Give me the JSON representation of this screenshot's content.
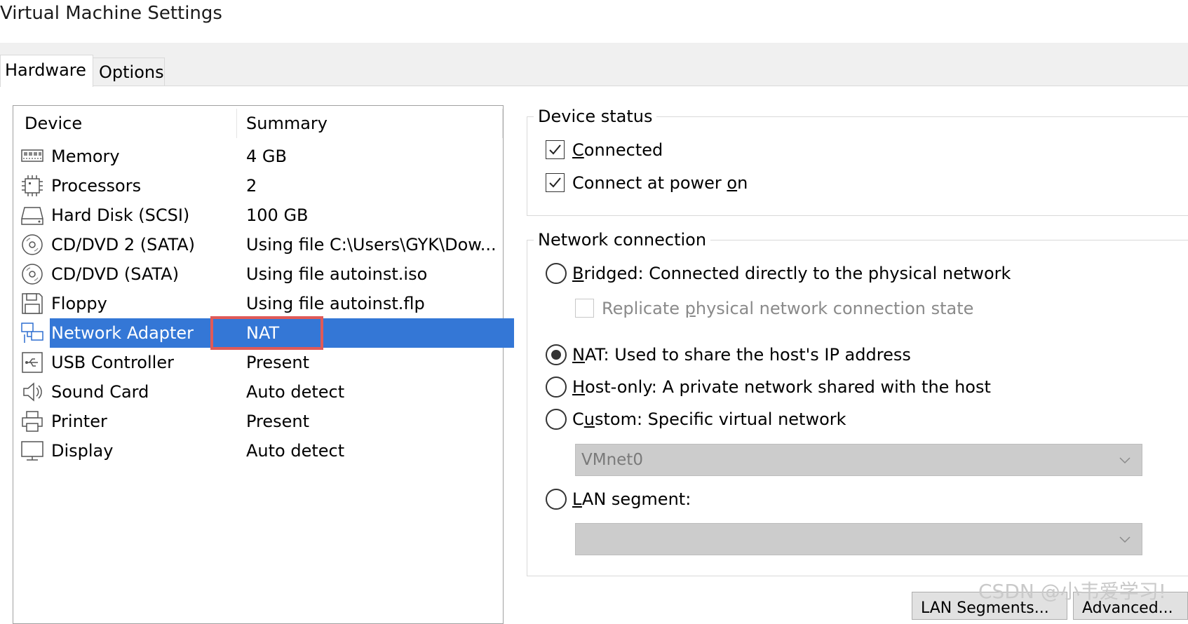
{
  "window": {
    "title": "Virtual Machine Settings"
  },
  "tabs": [
    {
      "label": "Hardware",
      "active": true
    },
    {
      "label": "Options",
      "active": false
    }
  ],
  "device_list": {
    "columns": [
      "Device",
      "Summary"
    ],
    "rows": [
      {
        "icon": "memory-icon",
        "device": "Memory",
        "summary": "4 GB"
      },
      {
        "icon": "processor-icon",
        "device": "Processors",
        "summary": "2"
      },
      {
        "icon": "hard-disk-icon",
        "device": "Hard Disk (SCSI)",
        "summary": "100 GB"
      },
      {
        "icon": "cd-dvd-icon",
        "device": "CD/DVD 2 (SATA)",
        "summary": "Using file C:\\Users\\GYK\\Dow..."
      },
      {
        "icon": "cd-dvd-icon",
        "device": "CD/DVD (SATA)",
        "summary": "Using file autoinst.iso"
      },
      {
        "icon": "floppy-icon",
        "device": "Floppy",
        "summary": "Using file autoinst.flp"
      },
      {
        "icon": "network-adapter-icon",
        "device": "Network Adapter",
        "summary": "NAT",
        "selected": true
      },
      {
        "icon": "usb-icon",
        "device": "USB Controller",
        "summary": "Present"
      },
      {
        "icon": "sound-card-icon",
        "device": "Sound Card",
        "summary": "Auto detect"
      },
      {
        "icon": "printer-icon",
        "device": "Printer",
        "summary": "Present"
      },
      {
        "icon": "display-icon",
        "device": "Display",
        "summary": "Auto detect"
      }
    ]
  },
  "device_status": {
    "title": "Device status",
    "connected": {
      "pre": "",
      "key": "C",
      "post": "onnected",
      "checked": true
    },
    "connect_at_power_on": {
      "pre": "Connect at power ",
      "key": "o",
      "post": "n",
      "checked": true
    }
  },
  "network_connection": {
    "title": "Network connection",
    "bridged": {
      "key": "B",
      "post": "ridged: Connected directly to the physical network",
      "selected": false
    },
    "replicate": {
      "pre": "Replicate ",
      "key": "p",
      "post": "hysical network connection state",
      "checked": false,
      "disabled": true
    },
    "nat": {
      "key": "N",
      "post": "AT: Used to share the host's IP address",
      "selected": true
    },
    "host_only": {
      "key": "H",
      "post": "ost-only: A private network shared with the host",
      "selected": false
    },
    "custom": {
      "pre": "C",
      "key": "u",
      "post": "stom: Specific virtual network",
      "selected": false
    },
    "vmnet_dropdown": {
      "value": "VMnet0"
    },
    "lan_segment": {
      "key": "L",
      "post": "AN segment:",
      "selected": false
    },
    "lan_dropdown": {
      "value": ""
    }
  },
  "buttons": {
    "lan_segments": "LAN Segments...",
    "advanced": "Advanced..."
  },
  "watermark": "CSDN @小韦爱学习!"
}
